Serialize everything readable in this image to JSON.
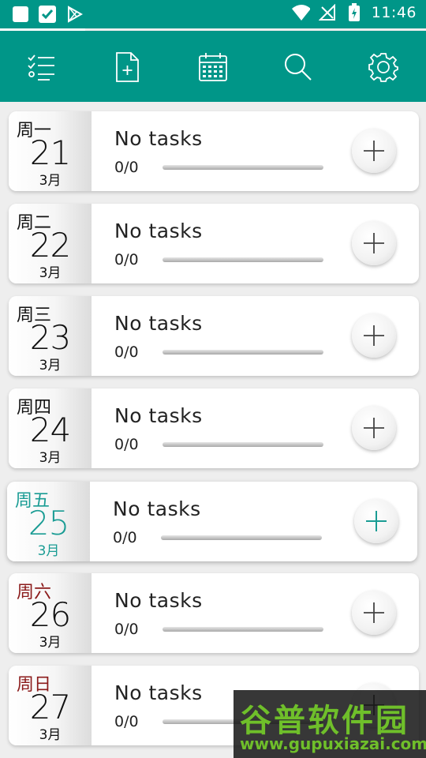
{
  "status_bar": {
    "time": "11:46",
    "left_icons": [
      "square-icon",
      "checkbox-icon",
      "play-store-icon"
    ],
    "right_icons": [
      "wifi-icon",
      "no-signal-icon",
      "battery-charging-icon"
    ]
  },
  "toolbar": {
    "buttons": [
      "task-list-icon",
      "new-document-icon",
      "calendar-icon",
      "search-icon",
      "settings-gear-icon"
    ]
  },
  "days": [
    {
      "weekday": "周一",
      "day": "21",
      "month": "3月",
      "title": "No tasks",
      "count": "0/0",
      "progress": 0
    },
    {
      "weekday": "周二",
      "day": "22",
      "month": "3月",
      "title": "No tasks",
      "count": "0/0",
      "progress": 0
    },
    {
      "weekday": "周三",
      "day": "23",
      "month": "3月",
      "title": "No tasks",
      "count": "0/0",
      "progress": 0
    },
    {
      "weekday": "周四",
      "day": "24",
      "month": "3月",
      "title": "No tasks",
      "count": "0/0",
      "progress": 0
    },
    {
      "weekday": "周五",
      "day": "25",
      "month": "3月",
      "title": "No tasks",
      "count": "0/0",
      "progress": 0
    },
    {
      "weekday": "周六",
      "day": "26",
      "month": "3月",
      "title": "No tasks",
      "count": "0/0",
      "progress": 0
    },
    {
      "weekday": "周日",
      "day": "27",
      "month": "3月",
      "title": "No tasks",
      "count": "0/0",
      "progress": 0
    }
  ],
  "colors": {
    "accent": "#009688",
    "today": "#1a9c94",
    "weekend": "#8b1a1a"
  },
  "watermark": {
    "line1": "谷普软件园",
    "line2": "www.gupuxiazai.com"
  }
}
